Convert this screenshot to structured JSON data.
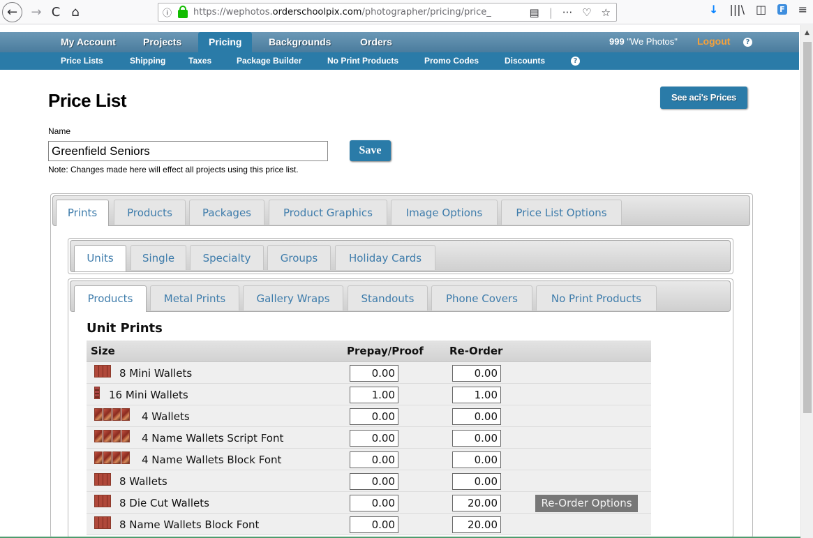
{
  "browser": {
    "back": "←",
    "forward": "→",
    "reload": "C",
    "home": "⌂",
    "url_prefix": "https://wephotos.",
    "url_domain": "orderschoolpix.com",
    "url_path": "/photographer/pricing/price_",
    "info_icon": "ⓘ",
    "reader_icon": "▤",
    "more_icon": "···",
    "pocket_icon": "♡",
    "star_icon": "☆",
    "download_icon": "↓",
    "library_icon": "|||\\",
    "sidebar_icon": "◫",
    "ext_label": "F",
    "menu_icon": "≡"
  },
  "main_nav": {
    "items": [
      "My Account",
      "Projects",
      "Pricing",
      "Backgrounds",
      "Orders"
    ],
    "active": "Pricing",
    "user_id": "999",
    "user_name": " \"We Photos\"",
    "logout": "Logout",
    "help": "?"
  },
  "sub_nav": {
    "items": [
      "Price Lists",
      "Shipping",
      "Taxes",
      "Package Builder",
      "No Print Products",
      "Promo Codes",
      "Discounts"
    ],
    "help": "?"
  },
  "page": {
    "title": "Price List",
    "see_prices_button": "See aci's Prices",
    "name_label": "Name",
    "name_value": "Greenfield Seniors",
    "save_button": "Save",
    "note": "Note: Changes made here will effect all projects using this price list."
  },
  "tabs_outer": {
    "items": [
      "Prints",
      "Products",
      "Packages",
      "Product Graphics",
      "Image Options",
      "Price List Options"
    ],
    "active": "Prints"
  },
  "tabs_mid": {
    "items": [
      "Units",
      "Single",
      "Specialty",
      "Groups",
      "Holiday Cards"
    ],
    "active": "Units"
  },
  "tabs_inner": {
    "items": [
      "Products",
      "Metal Prints",
      "Gallery Wraps",
      "Standouts",
      "Phone Covers",
      "No Print Products"
    ],
    "active": "Products"
  },
  "section": {
    "title": "Unit Prints",
    "columns": [
      "Size",
      "Prepay/Proof",
      "Re-Order"
    ],
    "reorder_options_label": "Re-Order Options",
    "rows": [
      {
        "label": "8 Mini Wallets",
        "prepay": "0.00",
        "reorder": "0.00",
        "thumb": "grid",
        "options": false
      },
      {
        "label": "16 Mini Wallets",
        "prepay": "1.00",
        "reorder": "1.00",
        "thumb": "small",
        "options": false
      },
      {
        "label": "4 Wallets",
        "prepay": "0.00",
        "reorder": "0.00",
        "thumb": "quad",
        "options": false
      },
      {
        "label": "4 Name Wallets Script Font",
        "prepay": "0.00",
        "reorder": "0.00",
        "thumb": "quad",
        "options": false
      },
      {
        "label": "4 Name Wallets Block Font",
        "prepay": "0.00",
        "reorder": "0.00",
        "thumb": "quad",
        "options": false
      },
      {
        "label": "8 Wallets",
        "prepay": "0.00",
        "reorder": "0.00",
        "thumb": "grid",
        "options": false
      },
      {
        "label": "8 Die Cut Wallets",
        "prepay": "0.00",
        "reorder": "20.00",
        "thumb": "grid",
        "options": true
      },
      {
        "label": "8 Name Wallets Block Font",
        "prepay": "0.00",
        "reorder": "20.00",
        "thumb": "grid",
        "options": false
      }
    ]
  }
}
